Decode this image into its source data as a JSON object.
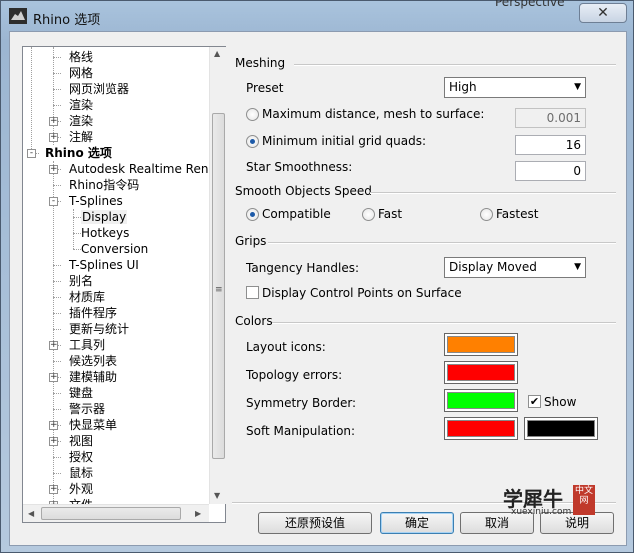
{
  "window": {
    "title": "Rhino 选项",
    "background_fragment": "Perspective",
    "close_symbol": "✕"
  },
  "tree": {
    "items": [
      {
        "label": "格线",
        "level": 2,
        "expander": null,
        "bold": false
      },
      {
        "label": "网格",
        "level": 2,
        "expander": null,
        "bold": false
      },
      {
        "label": "网页浏览器",
        "level": 2,
        "expander": null,
        "bold": false
      },
      {
        "label": "渲染",
        "level": 2,
        "expander": null,
        "bold": false
      },
      {
        "label": "渲染",
        "level": 2,
        "expander": "+",
        "bold": false
      },
      {
        "label": "注解",
        "level": 2,
        "expander": "+",
        "bold": false
      },
      {
        "label": "Rhino 选项",
        "level": 1,
        "expander": "-",
        "bold": true
      },
      {
        "label": "Autodesk Realtime Rendere",
        "level": 2,
        "expander": "+",
        "bold": false
      },
      {
        "label": "Rhino指令码",
        "level": 2,
        "expander": null,
        "bold": false
      },
      {
        "label": "T-Splines",
        "level": 2,
        "expander": "-",
        "bold": false
      },
      {
        "label": "Display",
        "level": 3,
        "expander": null,
        "bold": false,
        "selected": true
      },
      {
        "label": "Hotkeys",
        "level": 3,
        "expander": null,
        "bold": false
      },
      {
        "label": "Conversion",
        "level": 3,
        "expander": null,
        "bold": false
      },
      {
        "label": "T-Splines UI",
        "level": 2,
        "expander": null,
        "bold": false
      },
      {
        "label": "别名",
        "level": 2,
        "expander": null,
        "bold": false
      },
      {
        "label": "材质库",
        "level": 2,
        "expander": null,
        "bold": false
      },
      {
        "label": "插件程序",
        "level": 2,
        "expander": null,
        "bold": false
      },
      {
        "label": "更新与统计",
        "level": 2,
        "expander": null,
        "bold": false
      },
      {
        "label": "工具列",
        "level": 2,
        "expander": "+",
        "bold": false
      },
      {
        "label": "候选列表",
        "level": 2,
        "expander": null,
        "bold": false
      },
      {
        "label": "建模辅助",
        "level": 2,
        "expander": "+",
        "bold": false
      },
      {
        "label": "键盘",
        "level": 2,
        "expander": null,
        "bold": false
      },
      {
        "label": "警示器",
        "level": 2,
        "expander": null,
        "bold": false
      },
      {
        "label": "快显菜单",
        "level": 2,
        "expander": "+",
        "bold": false
      },
      {
        "label": "视图",
        "level": 2,
        "expander": "+",
        "bold": false
      },
      {
        "label": "授权",
        "level": 2,
        "expander": null,
        "bold": false
      },
      {
        "label": "鼠标",
        "level": 2,
        "expander": null,
        "bold": false
      },
      {
        "label": "外观",
        "level": 2,
        "expander": "+",
        "bold": false
      },
      {
        "label": "文件",
        "level": 2,
        "expander": "+",
        "bold": false
      }
    ]
  },
  "meshing": {
    "title": "Meshing",
    "preset_label": "Preset",
    "preset_value": "High",
    "max_distance_label": "Maximum distance, mesh to surface:",
    "max_distance_value": "0.001",
    "min_grid_label": "Minimum initial grid quads:",
    "min_grid_value": "16",
    "star_label": "Star Smoothness:",
    "star_value": "0"
  },
  "smooth": {
    "title": "Smooth Objects Speed",
    "compatible": "Compatible",
    "fast": "Fast",
    "fastest": "Fastest"
  },
  "grips": {
    "title": "Grips",
    "tangency_label": "Tangency Handles:",
    "tangency_value": "Display Moved",
    "display_cp_label": "Display Control Points on Surface"
  },
  "colors": {
    "title": "Colors",
    "layout_icons_label": "Layout icons:",
    "layout_icons_color": "#ff8000",
    "topology_label": "Topology errors:",
    "topology_color": "#ff0000",
    "symmetry_label": "Symmetry Border:",
    "symmetry_color": "#00ff00",
    "show_label": "Show",
    "soft_label": "Soft Manipulation:",
    "soft_color_1": "#ff0000",
    "soft_color_2": "#000000"
  },
  "buttons": {
    "restore": "还原预设值",
    "ok": "确定",
    "cancel": "取消",
    "help": "说明"
  },
  "watermark": {
    "text": "学犀牛",
    "badge": "中文网",
    "url": "xuexiniu.com"
  }
}
